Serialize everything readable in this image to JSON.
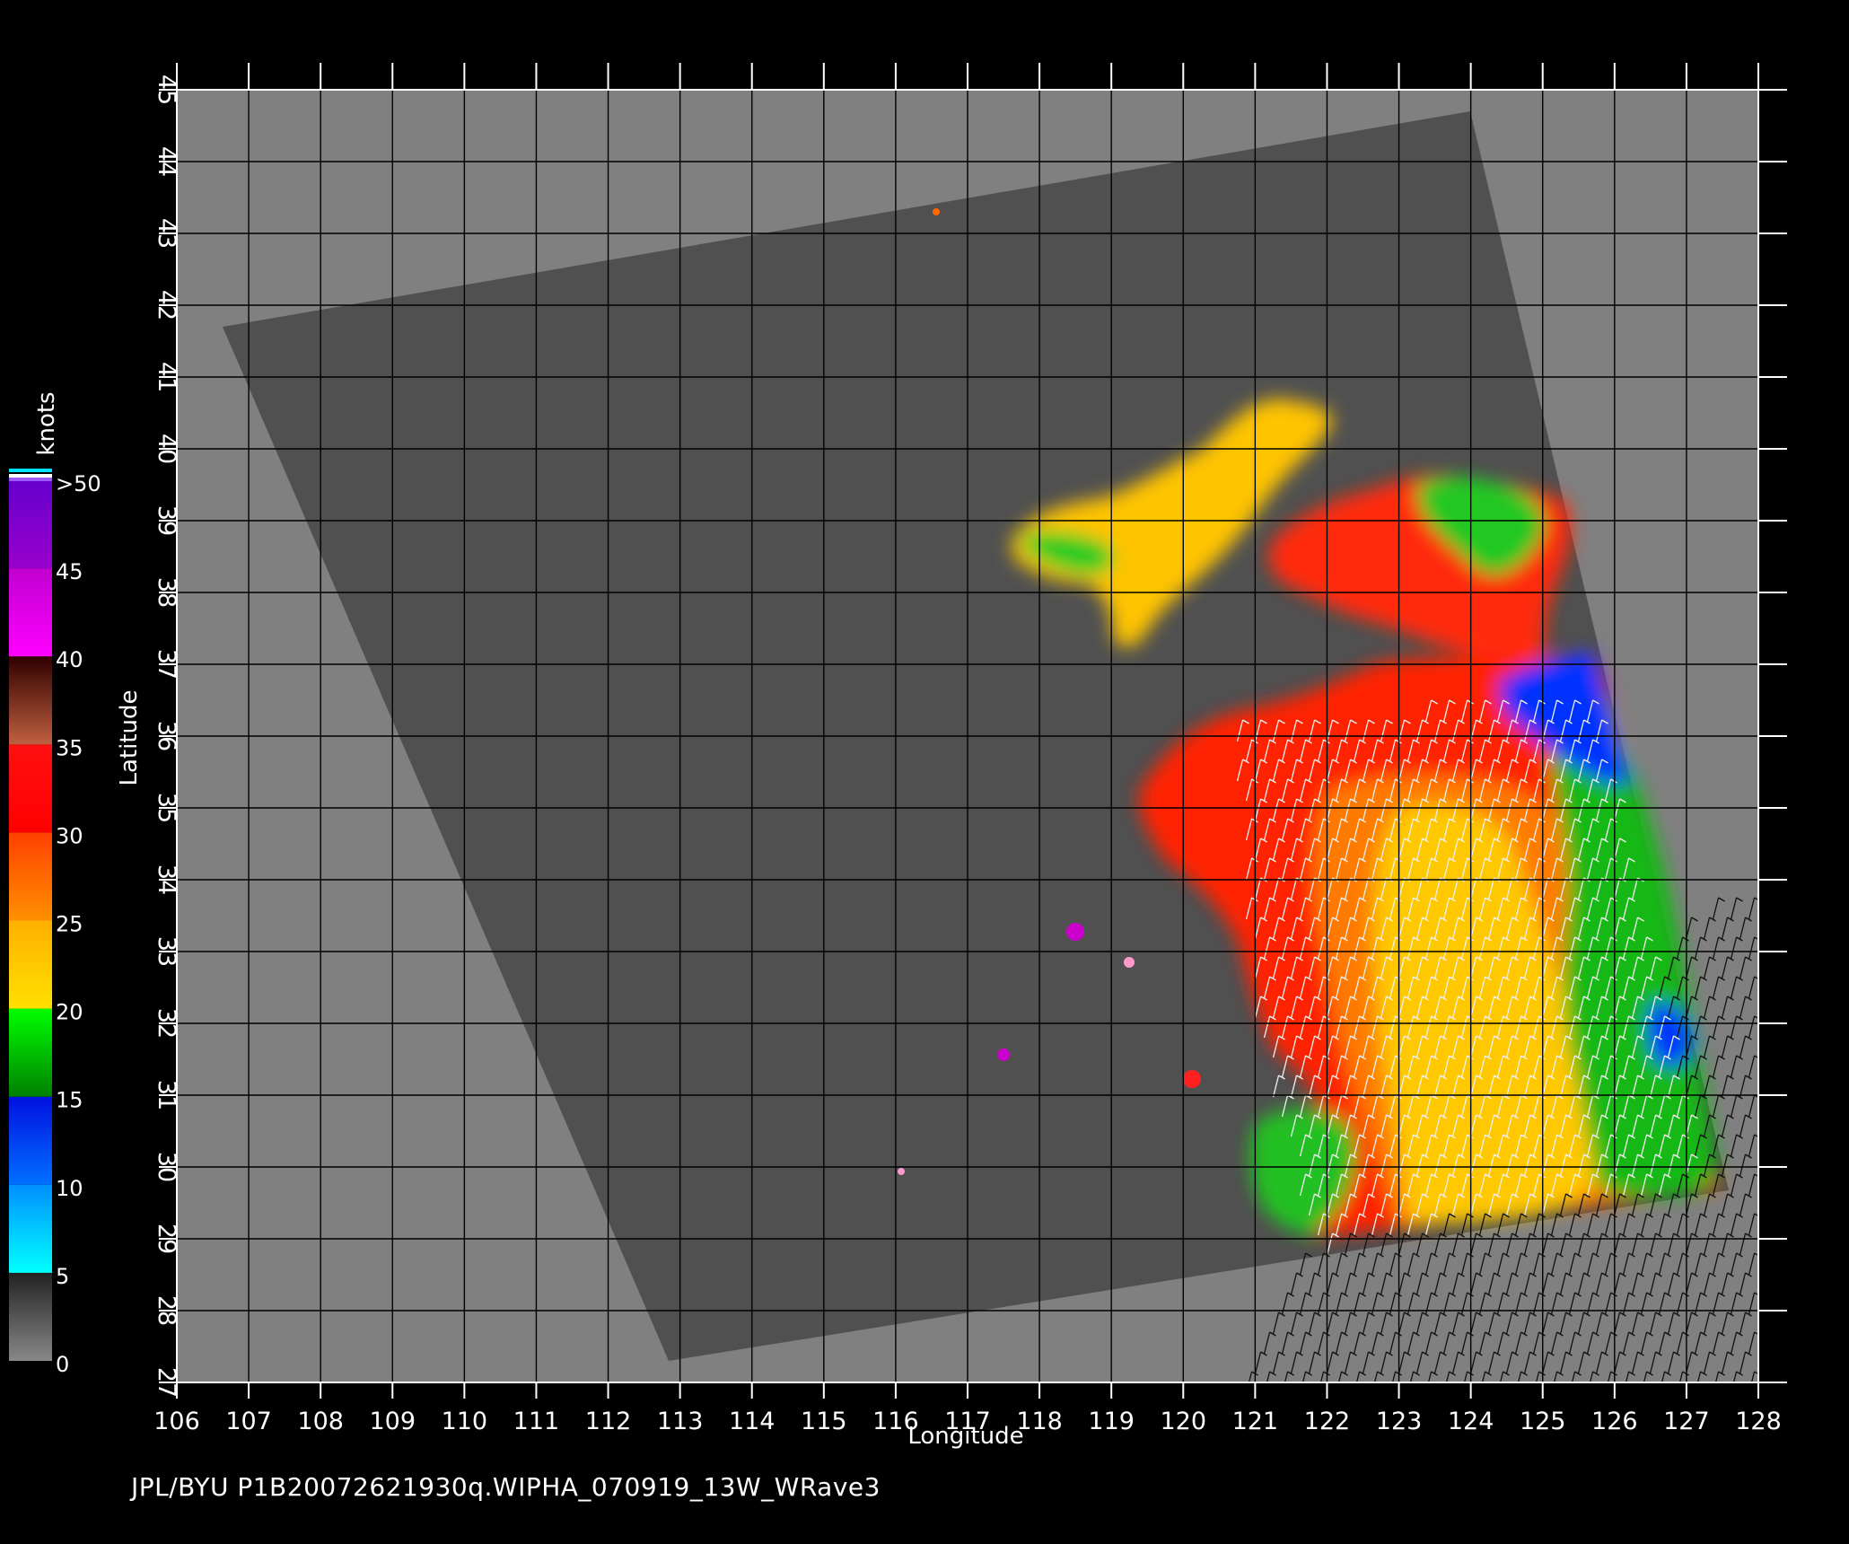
{
  "map": {
    "x_axis_label": "Longitude",
    "y_axis_label": "Latitude",
    "x_ticks": [
      "106",
      "107",
      "108",
      "109",
      "110",
      "111",
      "112",
      "113",
      "114",
      "115",
      "116",
      "117",
      "118",
      "119",
      "120",
      "121",
      "122",
      "123",
      "124",
      "125",
      "126",
      "127",
      "128"
    ],
    "y_ticks": [
      "27",
      "28",
      "29",
      "30",
      "31",
      "32",
      "33",
      "34",
      "35",
      "36",
      "37",
      "38",
      "39",
      "40",
      "41",
      "42",
      "43",
      "44",
      "45"
    ],
    "lon_range": [
      106,
      128
    ],
    "lat_range": [
      27,
      45
    ],
    "colors": {
      "background": "#000000",
      "outside_swath": "#808080",
      "swath": "#505050",
      "grid": "#000000"
    }
  },
  "legend": {
    "unit": "knots",
    "labels": [
      ">50",
      "45",
      "40",
      "35",
      "30",
      "25",
      "20",
      "15",
      "10",
      "5",
      "0"
    ],
    "bands": [
      {
        "from": 0,
        "to": 5,
        "colors": [
          "#888888",
          "#222222"
        ]
      },
      {
        "from": 5,
        "to": 10,
        "colors": [
          "#00ffff",
          "#0090ff"
        ]
      },
      {
        "from": 10,
        "to": 15,
        "colors": [
          "#0070ff",
          "#0010e0"
        ]
      },
      {
        "from": 15,
        "to": 20,
        "colors": [
          "#008000",
          "#00ff00"
        ]
      },
      {
        "from": 20,
        "to": 25,
        "colors": [
          "#ffe000",
          "#ffb000"
        ]
      },
      {
        "from": 25,
        "to": 30,
        "colors": [
          "#ff9000",
          "#ff4000"
        ]
      },
      {
        "from": 30,
        "to": 35,
        "colors": [
          "#ff0000",
          "#ff1010"
        ]
      },
      {
        "from": 35,
        "to": 40,
        "colors": [
          "#c06040",
          "#300000"
        ]
      },
      {
        "from": 40,
        "to": 45,
        "colors": [
          "#ff00ff",
          "#c000d0"
        ]
      },
      {
        "from": 45,
        "to": 50,
        "colors": [
          "#9900cc",
          "#6600cc"
        ]
      }
    ]
  },
  "footer_text": "JPL/BYU  P1B20072621930q.WIPHA_070919_13W_WRave3"
}
